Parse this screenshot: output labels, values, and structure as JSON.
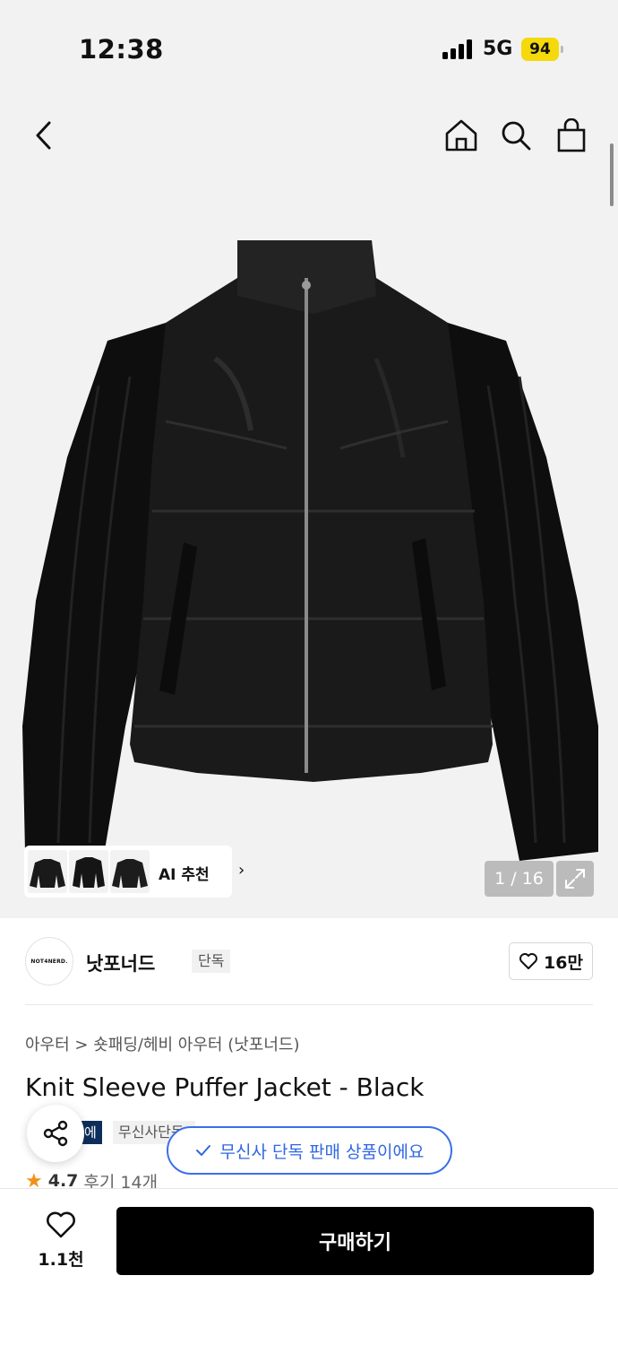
{
  "status": {
    "time": "12:38",
    "network": "5G",
    "battery": "94"
  },
  "gallery": {
    "ai_label": "AI 추천",
    "counter": "1 / 16"
  },
  "brand": {
    "logo_text": "NOT4NERD.",
    "name": "낫포너드",
    "badge": "단독",
    "likes": "16만"
  },
  "breadcrumb": "아우터 > 숏패딩/헤비 아우터 (낫포너드)",
  "product": {
    "title": "Knit Sleeve Puffer Jacket - Black",
    "tag_dark": "에이",
    "tag_light": "무신사단독",
    "exclusive_notice": "무신사 단독 판매 상품이에요",
    "rating": "4.7",
    "review": "후기 14개"
  },
  "bottom": {
    "wish_count": "1.1천",
    "buy_label": "구매하기"
  },
  "colors": {
    "accent_blue": "#2f67e3",
    "dark_tag": "#0d2d5a",
    "battery": "#f5d90a",
    "star": "#f0911b"
  },
  "icons": [
    "back-icon",
    "home-icon",
    "search-icon",
    "bag-icon",
    "expand-icon",
    "heart-icon",
    "share-icon",
    "check-icon",
    "star-icon"
  ]
}
